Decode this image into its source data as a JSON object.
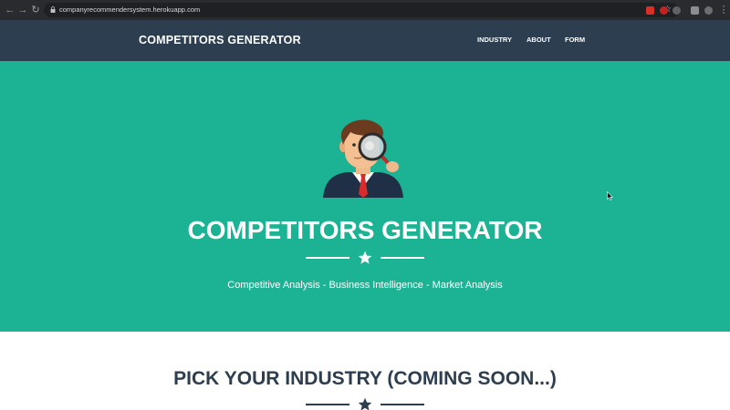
{
  "browser": {
    "url": "companyrecommendersystem.herokuapp.com",
    "icons": [
      "back-icon",
      "forward-icon",
      "reload-icon",
      "lock-icon",
      "bookmark-star-icon",
      "menu-icon"
    ]
  },
  "navbar": {
    "brand": "COMPETITORS GENERATOR",
    "links": [
      "INDUSTRY",
      "ABOUT",
      "FORM"
    ]
  },
  "hero": {
    "title": "COMPETITORS GENERATOR",
    "subtitle": "Competitive Analysis - Business Intelligence - Market Analysis",
    "image": "businessman-magnifying-glass-illustration"
  },
  "industry_section": {
    "title": "PICK YOUR INDUSTRY (COMING SOON...)"
  },
  "colors": {
    "navbar": "#2c3e50",
    "hero": "#1cb394",
    "text_light": "#ffffff",
    "text_dark": "#2c3e50"
  }
}
